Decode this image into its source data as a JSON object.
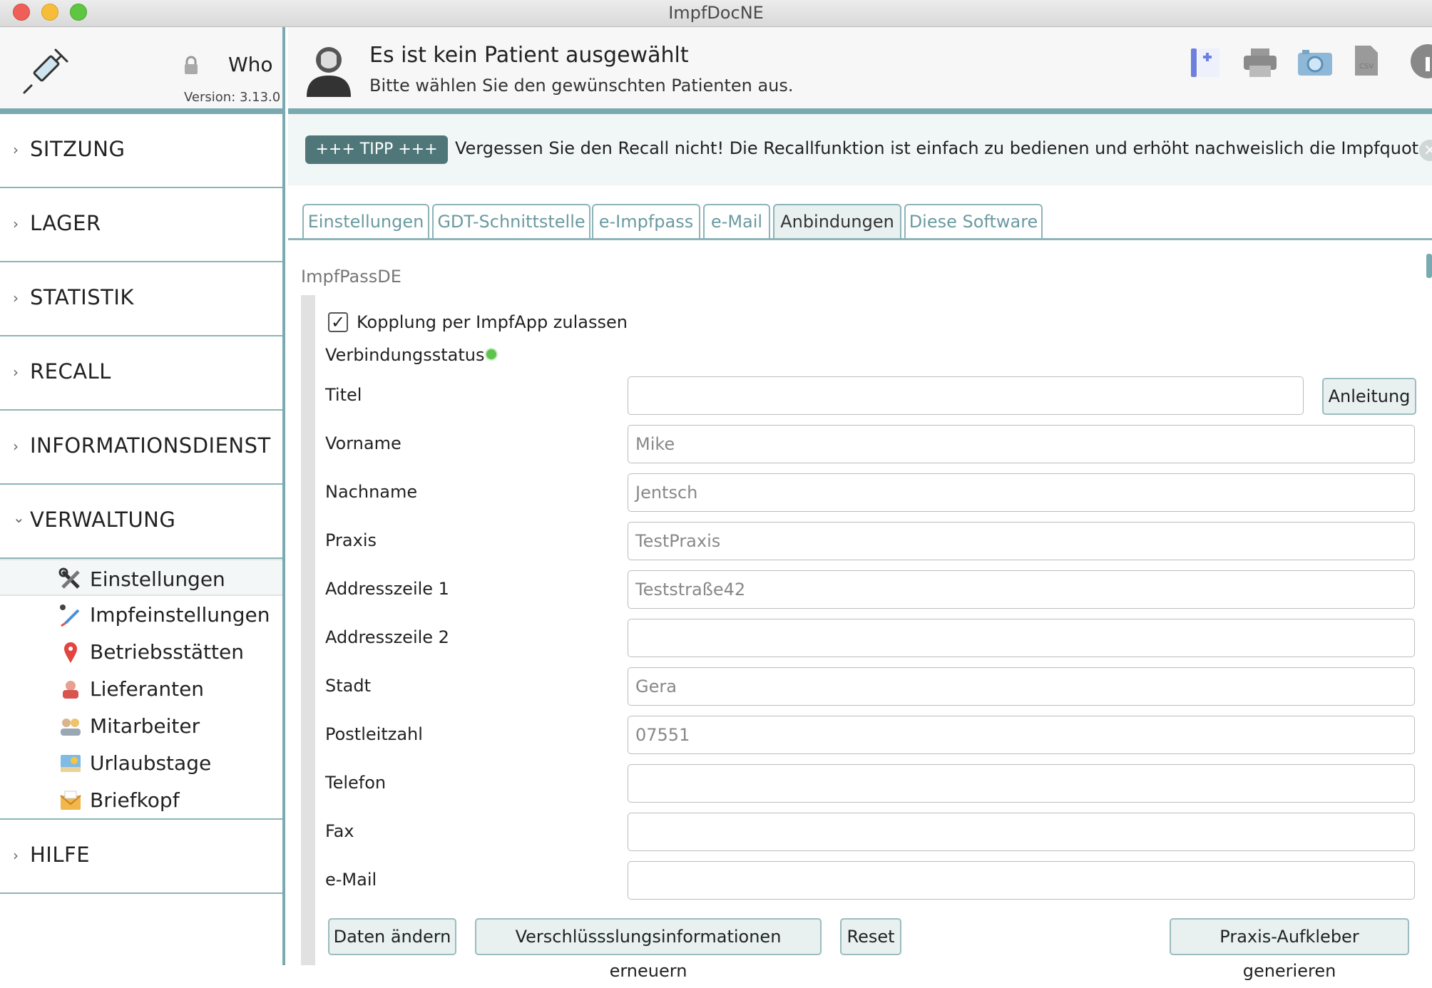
{
  "window": {
    "title": "ImpfDocNE"
  },
  "brand": {
    "user": "Who",
    "version": "Version: 3.13.0"
  },
  "header": {
    "title": "Es ist kein Patient ausgewählt",
    "subtitle": "Bitte wählen Sie den gewünschten Patienten aus."
  },
  "toolbar": {
    "icons": [
      "new-patient-icon",
      "print-icon",
      "camera-icon",
      "csv-icon",
      "info-icon"
    ]
  },
  "tip": {
    "badge": "+++ TIPP +++",
    "text": "Vergessen Sie den Recall nicht! Die Recallfunktion ist einfach zu bedienen und erhöht nachweislich die Impfquoten!"
  },
  "sidebar": {
    "sections": [
      {
        "label": "SITZUNG",
        "expanded": false
      },
      {
        "label": "LAGER",
        "expanded": false
      },
      {
        "label": "STATISTIK",
        "expanded": false
      },
      {
        "label": "RECALL",
        "expanded": false
      },
      {
        "label": "INFORMATIONSDIENST",
        "expanded": false
      },
      {
        "label": "VERWALTUNG",
        "expanded": true
      },
      {
        "label": "HILFE",
        "expanded": false
      }
    ],
    "subitems": [
      {
        "label": "Einstellungen",
        "icon": "tools-icon",
        "active": true
      },
      {
        "label": "Impfeinstellungen",
        "icon": "syringe-settings-icon"
      },
      {
        "label": "Betriebsstätten",
        "icon": "location-pin-icon"
      },
      {
        "label": "Lieferanten",
        "icon": "supplier-icon"
      },
      {
        "label": "Mitarbeiter",
        "icon": "staff-icon"
      },
      {
        "label": "Urlaubstage",
        "icon": "vacation-icon"
      },
      {
        "label": "Briefkopf",
        "icon": "letterhead-icon"
      }
    ]
  },
  "tabs": [
    {
      "label": "Einstellungen"
    },
    {
      "label": "GDT-Schnittstelle"
    },
    {
      "label": "e-Impfpass"
    },
    {
      "label": "e-Mail"
    },
    {
      "label": "Anbindungen",
      "selected": true
    },
    {
      "label": "Diese Software"
    }
  ],
  "form": {
    "section_title": "ImpfPassDE",
    "checkbox_label": "Kopplung per ImpfApp zulassen",
    "checkbox_checked": true,
    "status_label": "Verbindungsstatus",
    "status_color": "#5cc44a",
    "anleitung": "Anleitung",
    "fields": [
      {
        "label": "Titel",
        "value": ""
      },
      {
        "label": "Vorname",
        "value": "Mike"
      },
      {
        "label": "Nachname",
        "value": "Jentsch"
      },
      {
        "label": "Praxis",
        "value": "TestPraxis"
      },
      {
        "label": "Addresszeile 1",
        "value": "Teststraße42"
      },
      {
        "label": "Addresszeile 2",
        "value": ""
      },
      {
        "label": "Stadt",
        "value": "Gera"
      },
      {
        "label": "Postleitzahl",
        "value": "07551"
      },
      {
        "label": "Telefon",
        "value": ""
      },
      {
        "label": "Fax",
        "value": ""
      },
      {
        "label": "e-Mail",
        "value": ""
      }
    ],
    "buttons": {
      "change": "Daten ändern",
      "renew": "Verschlüssslungsinformationen erneuern",
      "reset": "Reset",
      "sticker": "Praxis-Aufkleber generieren"
    }
  },
  "colors": {
    "accent": "#7aaab0",
    "tip_badge": "#4f7779"
  }
}
